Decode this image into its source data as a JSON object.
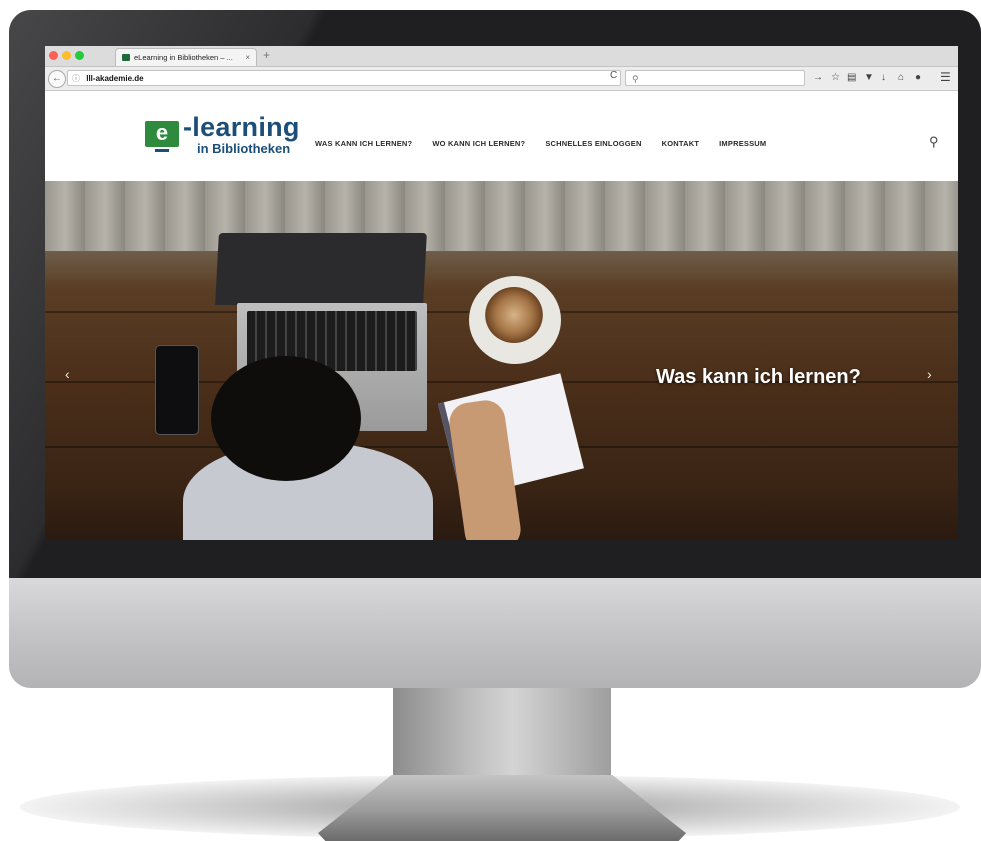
{
  "browser": {
    "tab_title": "eLearning in Bibliotheken – ...",
    "tab_close": "×",
    "new_tab": "+",
    "url": "lll-akademie.de",
    "info_icon": "ⓘ",
    "reload_icon": "C",
    "search_icon": "search-icon",
    "toolbar_icons": [
      "forward-arrow-icon",
      "star-icon",
      "reader-icon",
      "pocket-icon",
      "download-icon",
      "home-icon",
      "chat-icon",
      "menu-icon"
    ]
  },
  "site": {
    "logo_mark": "e",
    "logo_title": "-learning",
    "logo_subtitle": "in Bibliotheken",
    "menu": [
      "WAS KANN ICH LERNEN?",
      "WO KANN ICH LERNEN?",
      "SCHNELLES EINLOGGEN",
      "KONTAKT",
      "IMPRESSUM"
    ],
    "hero_caption": "Was kann ich lernen?",
    "slider_prev": "‹",
    "slider_next": "›"
  },
  "colors": {
    "brand_green": "#2e8b3d",
    "brand_blue": "#1b4f7a"
  }
}
